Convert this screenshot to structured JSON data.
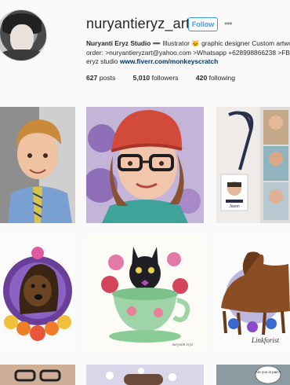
{
  "profile": {
    "username": "nuryantieryz_art",
    "follow_label": "Follow",
    "more_icon": "more-dots-icon",
    "bio": {
      "name": "Nuryanti Eryz Studio",
      "line1_rest": " ➖ Illustrator 🐱 graphic designer Custom artwork",
      "line2": "order: >nuryantieryzart@yahoo.com >Whatsapp +628998866238 >FB",
      "line3_prefix": "eryz studio ",
      "link": "www.fiverr.com/monkeyscratch"
    },
    "stats": {
      "posts_count": "627",
      "posts_label": "posts",
      "followers_count": "5,010",
      "followers_label": "followers",
      "following_count": "420",
      "following_label": "following"
    }
  },
  "posts": [
    {
      "name": "post-boy-portrait"
    },
    {
      "name": "post-woman-beanie-portrait"
    },
    {
      "name": "post-lanyard-mockup"
    },
    {
      "name": "post-dog-floral"
    },
    {
      "name": "post-cat-teacup"
    },
    {
      "name": "post-horse-floral"
    },
    {
      "name": "post-partial-1"
    },
    {
      "name": "post-partial-2"
    },
    {
      "name": "post-partial-3"
    }
  ],
  "colors": {
    "accent": "#3897f0",
    "text": "#262626",
    "link": "#003569",
    "background": "#fafafa"
  },
  "art_text": {
    "lanyard_name": "Jason",
    "horse_signature": "Linkforist",
    "cat_signature": "nuryanti eryz",
    "partial_bubble": "Are you in pain?"
  }
}
